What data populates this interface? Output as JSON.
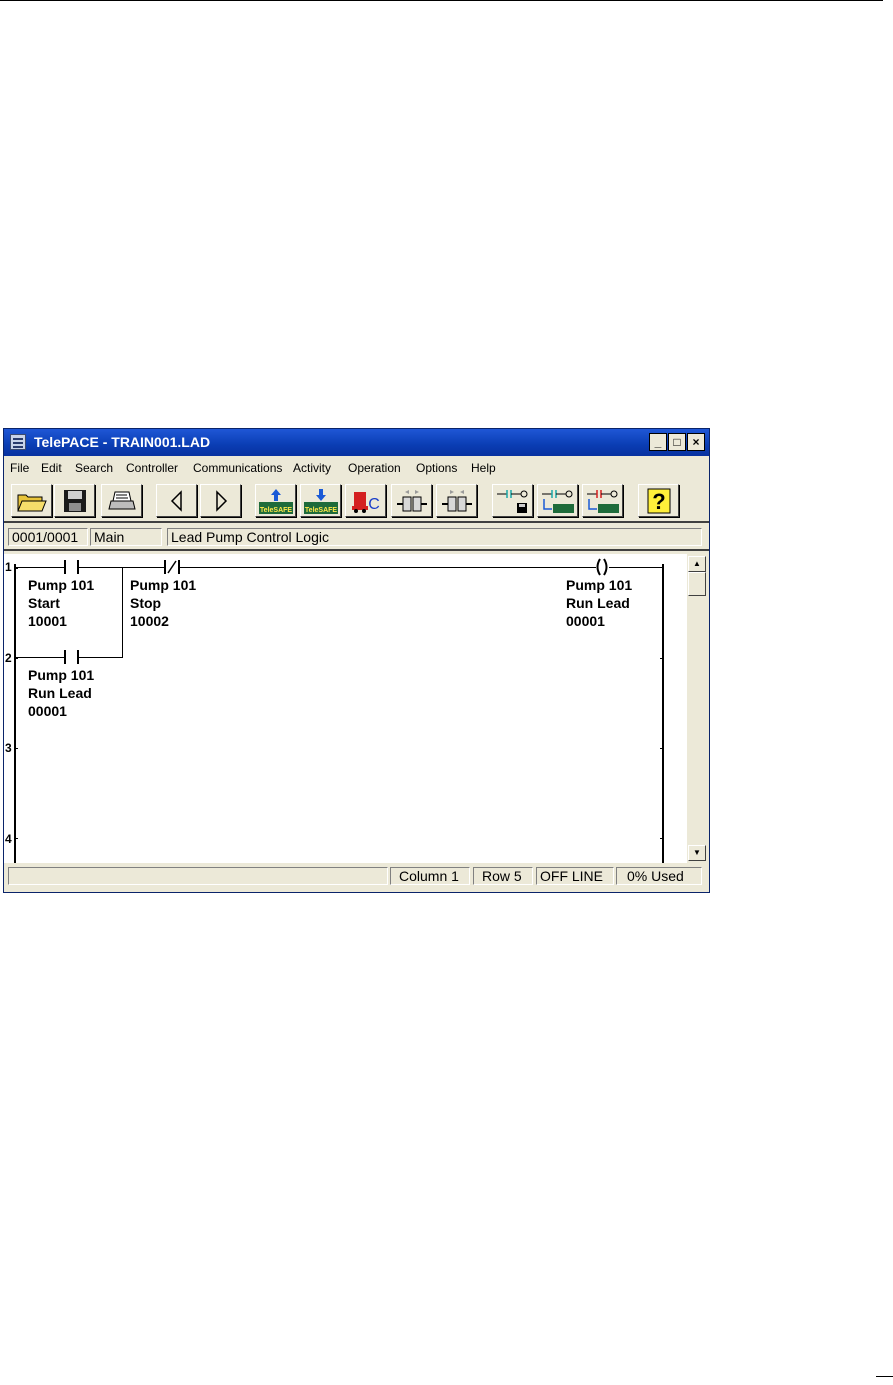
{
  "window": {
    "title": "TelePACE - TRAIN001.LAD"
  },
  "title_buttons": {
    "minimize": "_",
    "maximize": "□",
    "close": "×"
  },
  "menu": [
    "File",
    "Edit",
    "Search",
    "Controller",
    "Communications",
    "Activity",
    "Operation",
    "Options",
    "Help"
  ],
  "toolbar": {
    "buttons": [
      "open-icon",
      "save-icon",
      "print-icon",
      "back-arrow-icon",
      "forward-arrow-icon",
      "telesafe-upload-icon",
      "telesafe-download-icon",
      "controller-icon",
      "connect-left-icon",
      "connect-right-icon",
      "ladder-save-icon",
      "ladder-telesafe-icon",
      "ladder-telesafe-red-icon",
      "help-icon"
    ],
    "telesafe_label": "TeleSAFE",
    "controller_letter": "C",
    "help_glyph": "?"
  },
  "info": {
    "position": "0001/0001",
    "network": "Main",
    "description": "Lead Pump Control Logic"
  },
  "rungs": [
    "1",
    "2",
    "3",
    "4"
  ],
  "elements": {
    "start": {
      "line1": "Pump 101",
      "line2": "Start",
      "line3": "10001"
    },
    "stop": {
      "line1": "Pump 101",
      "line2": "Stop",
      "line3": "10002"
    },
    "coil": {
      "line1": "Pump 101",
      "line2": "Run Lead",
      "line3": "00001"
    },
    "seal": {
      "line1": "Pump 101",
      "line2": "Run Lead",
      "line3": "00001"
    }
  },
  "status": {
    "column": "Column 1",
    "row": "Row 5",
    "mode": "OFF LINE",
    "used": "0% Used"
  }
}
